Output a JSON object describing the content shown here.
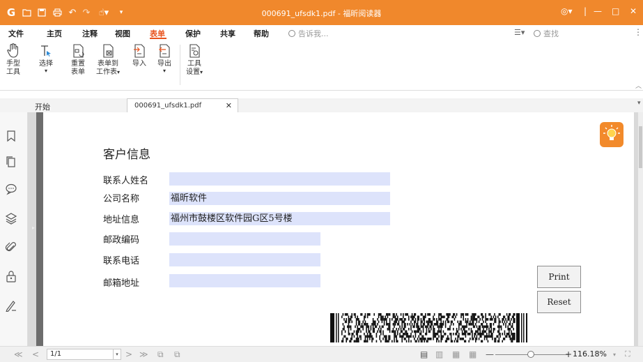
{
  "window": {
    "title": "000691_ufsdk1.pdf - 福昕阅读器"
  },
  "menu": {
    "items": [
      "文件",
      "主页",
      "注释",
      "视图",
      "表单",
      "保护",
      "共享",
      "帮助"
    ],
    "active": "表单",
    "tell_me_placeholder": "告诉我...",
    "search_placeholder": "查找"
  },
  "ribbon": {
    "hand_tool": "手型\n工具",
    "hand_tool_l1": "手型",
    "hand_tool_l2": "工具",
    "select": "选择",
    "reset_form_l1": "重置",
    "reset_form_l2": "表单",
    "form_to_sheet_l1": "表单到",
    "form_to_sheet_l2": "工作表",
    "import": "导入",
    "export": "导出",
    "tool_settings_l1": "工具",
    "tool_settings_l2": "设置"
  },
  "tabs": {
    "start": "开始",
    "document": "000691_ufsdk1.pdf"
  },
  "form": {
    "title": "客户信息",
    "fields": [
      {
        "label": "联系人姓名",
        "value": ""
      },
      {
        "label": "公司名称",
        "value": "福昕软件"
      },
      {
        "label": "地址信息",
        "value": "福州市鼓楼区软件园G区5号楼"
      },
      {
        "label": "邮政编码",
        "value": ""
      },
      {
        "label": "联系电话",
        "value": ""
      },
      {
        "label": "邮箱地址",
        "value": ""
      }
    ],
    "print_button": "Print",
    "reset_button": "Reset"
  },
  "status": {
    "page_indicator": "1/1",
    "zoom": "116.18%"
  },
  "colors": {
    "brand": "#f0882c",
    "active_menu": "#e8541f",
    "field_fill": "#dde3fb"
  }
}
